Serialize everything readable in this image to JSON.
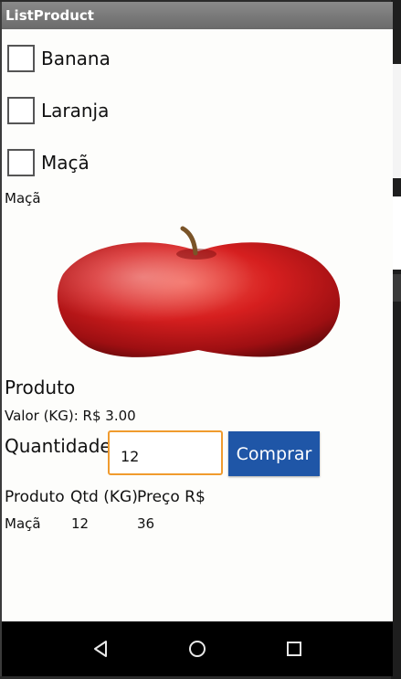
{
  "app": {
    "title": "ListProduct"
  },
  "products": [
    {
      "label": "Banana",
      "checked": false
    },
    {
      "label": "Laranja",
      "checked": false
    },
    {
      "label": "Maçã",
      "checked": false
    }
  ],
  "selected": {
    "name": "Maçã",
    "image_icon": "apple-image",
    "heading": "Produto",
    "price_text": "Valor (KG): R$ 3.00"
  },
  "order": {
    "quantity_label": "Quantidade",
    "quantity_value": "12",
    "buy_label": "Comprar"
  },
  "table": {
    "headers": [
      "Produto",
      "Qtd (KG)",
      "Preço R$"
    ],
    "rows": [
      [
        "Maçã",
        "12",
        "36"
      ]
    ]
  },
  "navbar": {
    "icons": [
      "back-icon",
      "home-icon",
      "recents-icon"
    ]
  },
  "colors": {
    "titlebar": "#7a7a7a",
    "button": "#1f56a7",
    "input_focus": "#f09b2e",
    "background": "#fdfdfb"
  }
}
